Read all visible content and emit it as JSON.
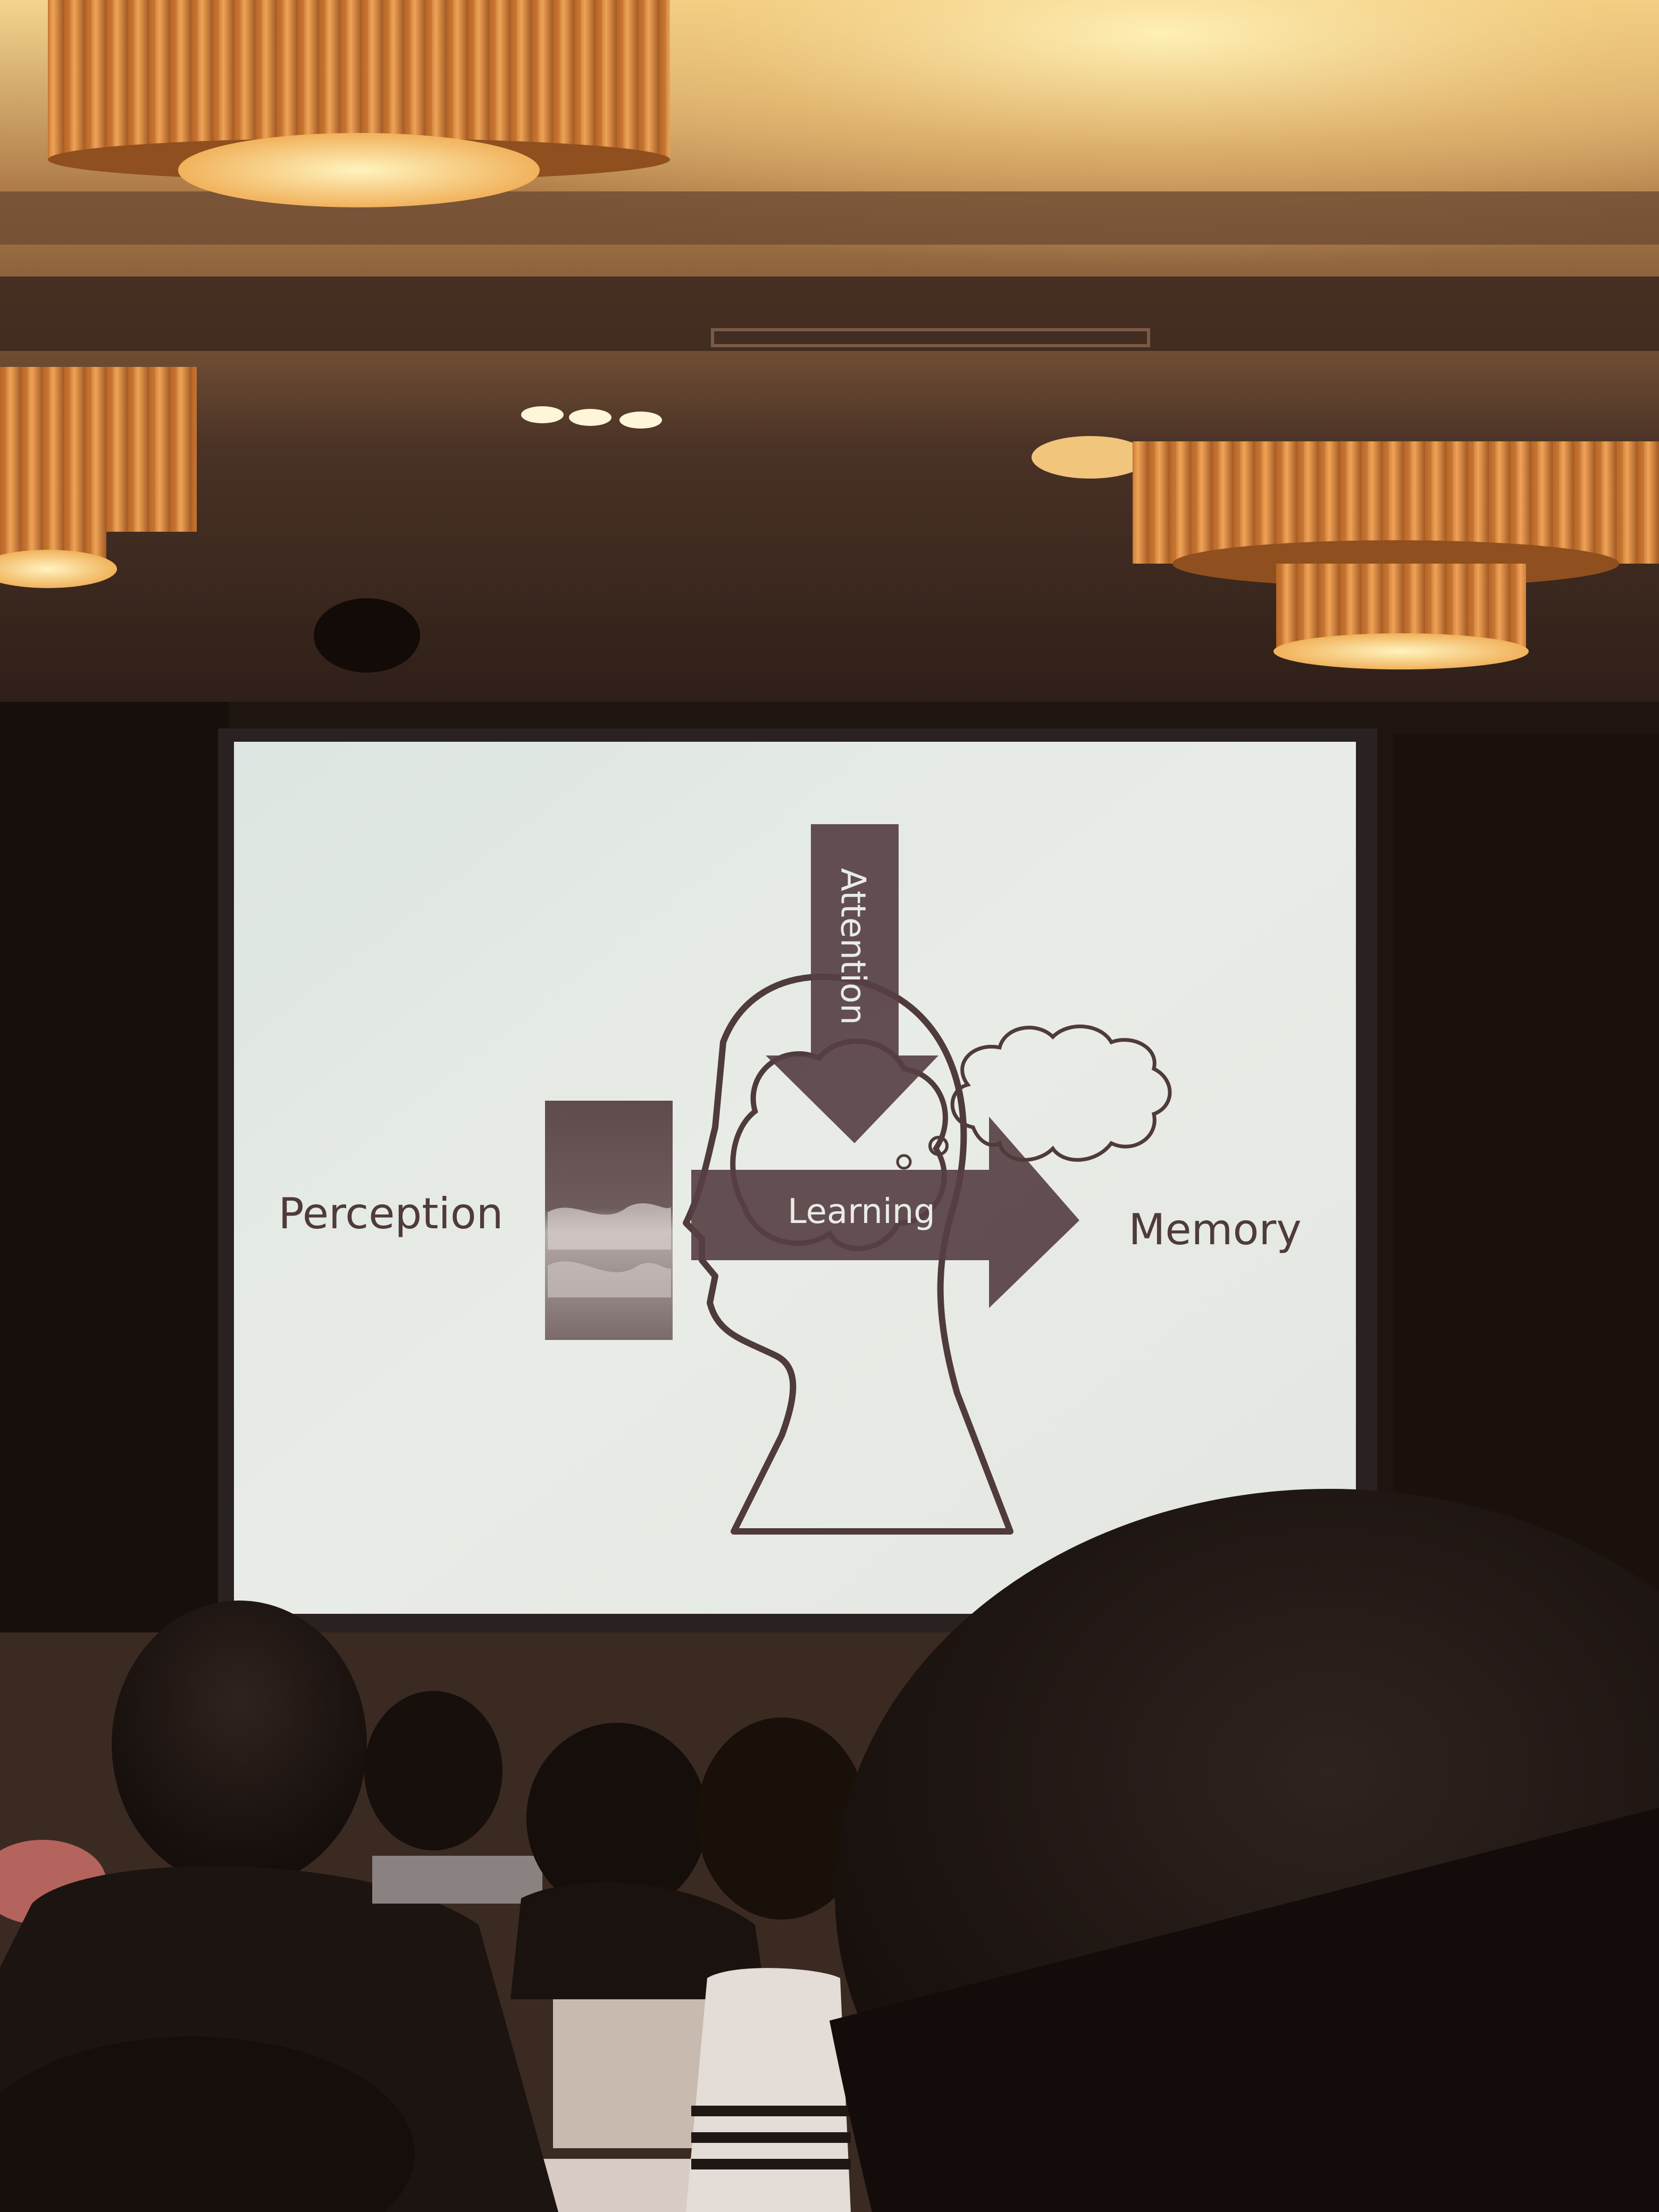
{
  "slide": {
    "labels": {
      "perception": "Perception",
      "attention": "Attention",
      "learning": "Learning",
      "memory": "Memory"
    }
  },
  "colors": {
    "screen": "#e7ebe6",
    "arrow": "#574045",
    "text": "#4f3a3c",
    "ceiling_light": "#f5d789",
    "lamp_shade": "#d88a3c",
    "room_dark": "#1b120e"
  }
}
